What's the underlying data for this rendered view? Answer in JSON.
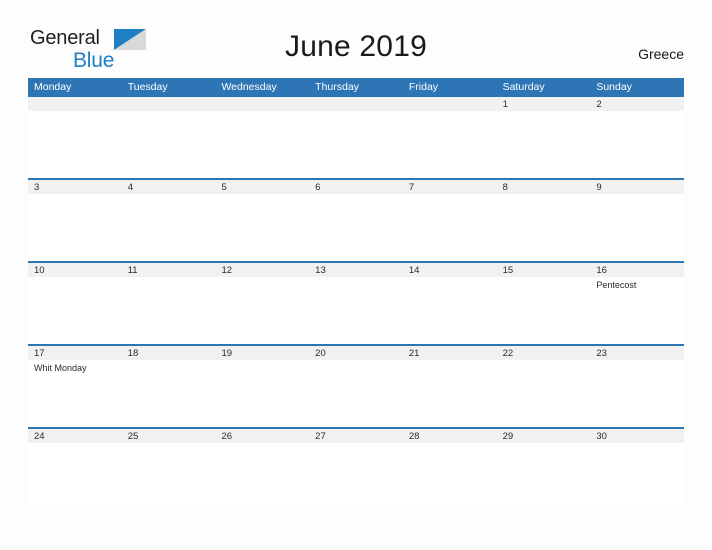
{
  "brand": {
    "name_part1": "General",
    "name_part2": "Blue",
    "flag_icon": "blue-triangle-flag-icon",
    "color_dark": "#231f20",
    "color_blue": "#1f7fc4"
  },
  "header": {
    "title": "June 2019",
    "region": "Greece"
  },
  "theme": {
    "header_blue": "#2e75b6",
    "row_separator_blue": "#2e75b6",
    "day_band_gray": "#f1f1f1",
    "page_background": "#fdfdfd",
    "text_dark": "#2a2a2a"
  },
  "calendar": {
    "month": "June",
    "year": "2019",
    "weekdays": [
      "Monday",
      "Tuesday",
      "Wednesday",
      "Thursday",
      "Friday",
      "Saturday",
      "Sunday"
    ],
    "weeks": [
      [
        {
          "date": "",
          "events": []
        },
        {
          "date": "",
          "events": []
        },
        {
          "date": "",
          "events": []
        },
        {
          "date": "",
          "events": []
        },
        {
          "date": "",
          "events": []
        },
        {
          "date": "1",
          "events": []
        },
        {
          "date": "2",
          "events": []
        }
      ],
      [
        {
          "date": "3",
          "events": []
        },
        {
          "date": "4",
          "events": []
        },
        {
          "date": "5",
          "events": []
        },
        {
          "date": "6",
          "events": []
        },
        {
          "date": "7",
          "events": []
        },
        {
          "date": "8",
          "events": []
        },
        {
          "date": "9",
          "events": []
        }
      ],
      [
        {
          "date": "10",
          "events": []
        },
        {
          "date": "11",
          "events": []
        },
        {
          "date": "12",
          "events": []
        },
        {
          "date": "13",
          "events": []
        },
        {
          "date": "14",
          "events": []
        },
        {
          "date": "15",
          "events": []
        },
        {
          "date": "16",
          "events": [
            "Pentecost"
          ]
        }
      ],
      [
        {
          "date": "17",
          "events": [
            "Whit Monday"
          ]
        },
        {
          "date": "18",
          "events": []
        },
        {
          "date": "19",
          "events": []
        },
        {
          "date": "20",
          "events": []
        },
        {
          "date": "21",
          "events": []
        },
        {
          "date": "22",
          "events": []
        },
        {
          "date": "23",
          "events": []
        }
      ],
      [
        {
          "date": "24",
          "events": []
        },
        {
          "date": "25",
          "events": []
        },
        {
          "date": "26",
          "events": []
        },
        {
          "date": "27",
          "events": []
        },
        {
          "date": "28",
          "events": []
        },
        {
          "date": "29",
          "events": []
        },
        {
          "date": "30",
          "events": []
        }
      ]
    ]
  }
}
